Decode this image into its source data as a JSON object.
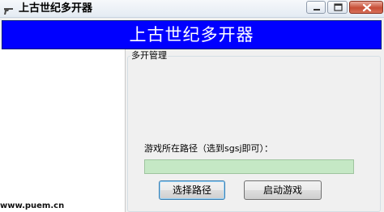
{
  "window": {
    "title": "上古世纪多开器"
  },
  "banner": {
    "title": "上古世纪多开器",
    "color": "#0000ff"
  },
  "group": {
    "legend": "多开管理",
    "path_label": "游戏所在路径（选到sgsj即可）：",
    "path_input": {
      "value": "",
      "placeholder": ""
    }
  },
  "buttons": {
    "select_path": "选择路径",
    "start_game": "启动游戏"
  },
  "watermark": "www.puem.cn",
  "icons": {
    "app": "pistol-icon",
    "minimize": "minimize-icon",
    "maximize": "maximize-icon",
    "close": "close-icon"
  }
}
